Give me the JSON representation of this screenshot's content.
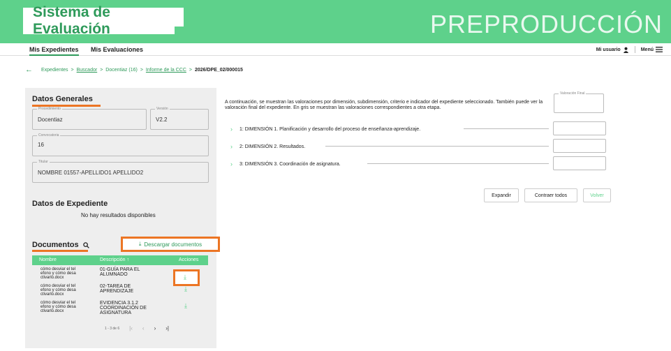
{
  "header": {
    "app_title": "Sistema de Evaluación",
    "environment": "PREPRODUCCIÓN"
  },
  "nav": {
    "tabs": [
      {
        "label": "Mis Expedientes"
      },
      {
        "label": "Mis Evaluaciones"
      }
    ],
    "user_label": "Mi usuario",
    "menu_label": "Menú"
  },
  "breadcrumb": {
    "items": [
      "Expedientes",
      "Buscador",
      "Docentiaz (16)",
      "Informe de la CCC"
    ],
    "current": "2026/DPE_02/000015",
    "separator": ">"
  },
  "datos_generales": {
    "title": "Datos Generales",
    "procedimiento_label": "Procedimiento",
    "procedimiento": "Docentiaz",
    "version_label": "Versión",
    "version": "V2.2",
    "convocatoria_label": "Convocatoria",
    "convocatoria": "16",
    "titular_label": "Titular",
    "titular": "NOMBRE 01557-APELLIDO1 APELLIDO2"
  },
  "datos_expediente": {
    "title": "Datos de Expediente",
    "empty_text": "No hay resultados disponibles"
  },
  "documentos": {
    "title": "Documentos",
    "download_all_label": "Descargar documentos",
    "columns": [
      "Nombre",
      "Descripción ↑",
      "Acciones"
    ],
    "rows": [
      {
        "nombre": "cómo desviar el tel efono y cómo desa ctivarlo.docx",
        "descripcion": "01-GUÍA PARA EL ALUMNADO"
      },
      {
        "nombre": "cómo desviar el tel efono y cómo desa ctivarlo.docx",
        "descripcion": "02-TAREA DE APRENDIZAJE"
      },
      {
        "nombre": "cómo desviar el tel efono y cómo desa ctivarlo.docx",
        "descripcion": "EVIDENCIA 3.1.2 COORDINACIÓN DE ASIGNATURA"
      }
    ],
    "pagination": "1 - 3 de 6"
  },
  "main": {
    "description": "A continuación, se muestran las valoraciones por dimensión, subdimensión, criterio e indicador del expediente seleccionado. También puede ver la valoración final del expediente. En gris se muestran las valoraciones correspondientes a otra etapa.",
    "valoracion_final_label": "Valoración Final",
    "dimensions": [
      {
        "label": "1: DIMENSIÓN 1. Planificación y desarrollo del proceso de enseñanza-aprendizaje."
      },
      {
        "label": "2: DIMENSIÓN 2. Resultados."
      },
      {
        "label": "3: DIMENSIÓN 3. Coordinación de asignatura."
      }
    ],
    "buttons": {
      "expand": "Expandir",
      "collapse": "Contraer todos",
      "back": "Volver"
    }
  },
  "colors": {
    "accent": "#5ed18b",
    "highlight": "#ec7524"
  }
}
